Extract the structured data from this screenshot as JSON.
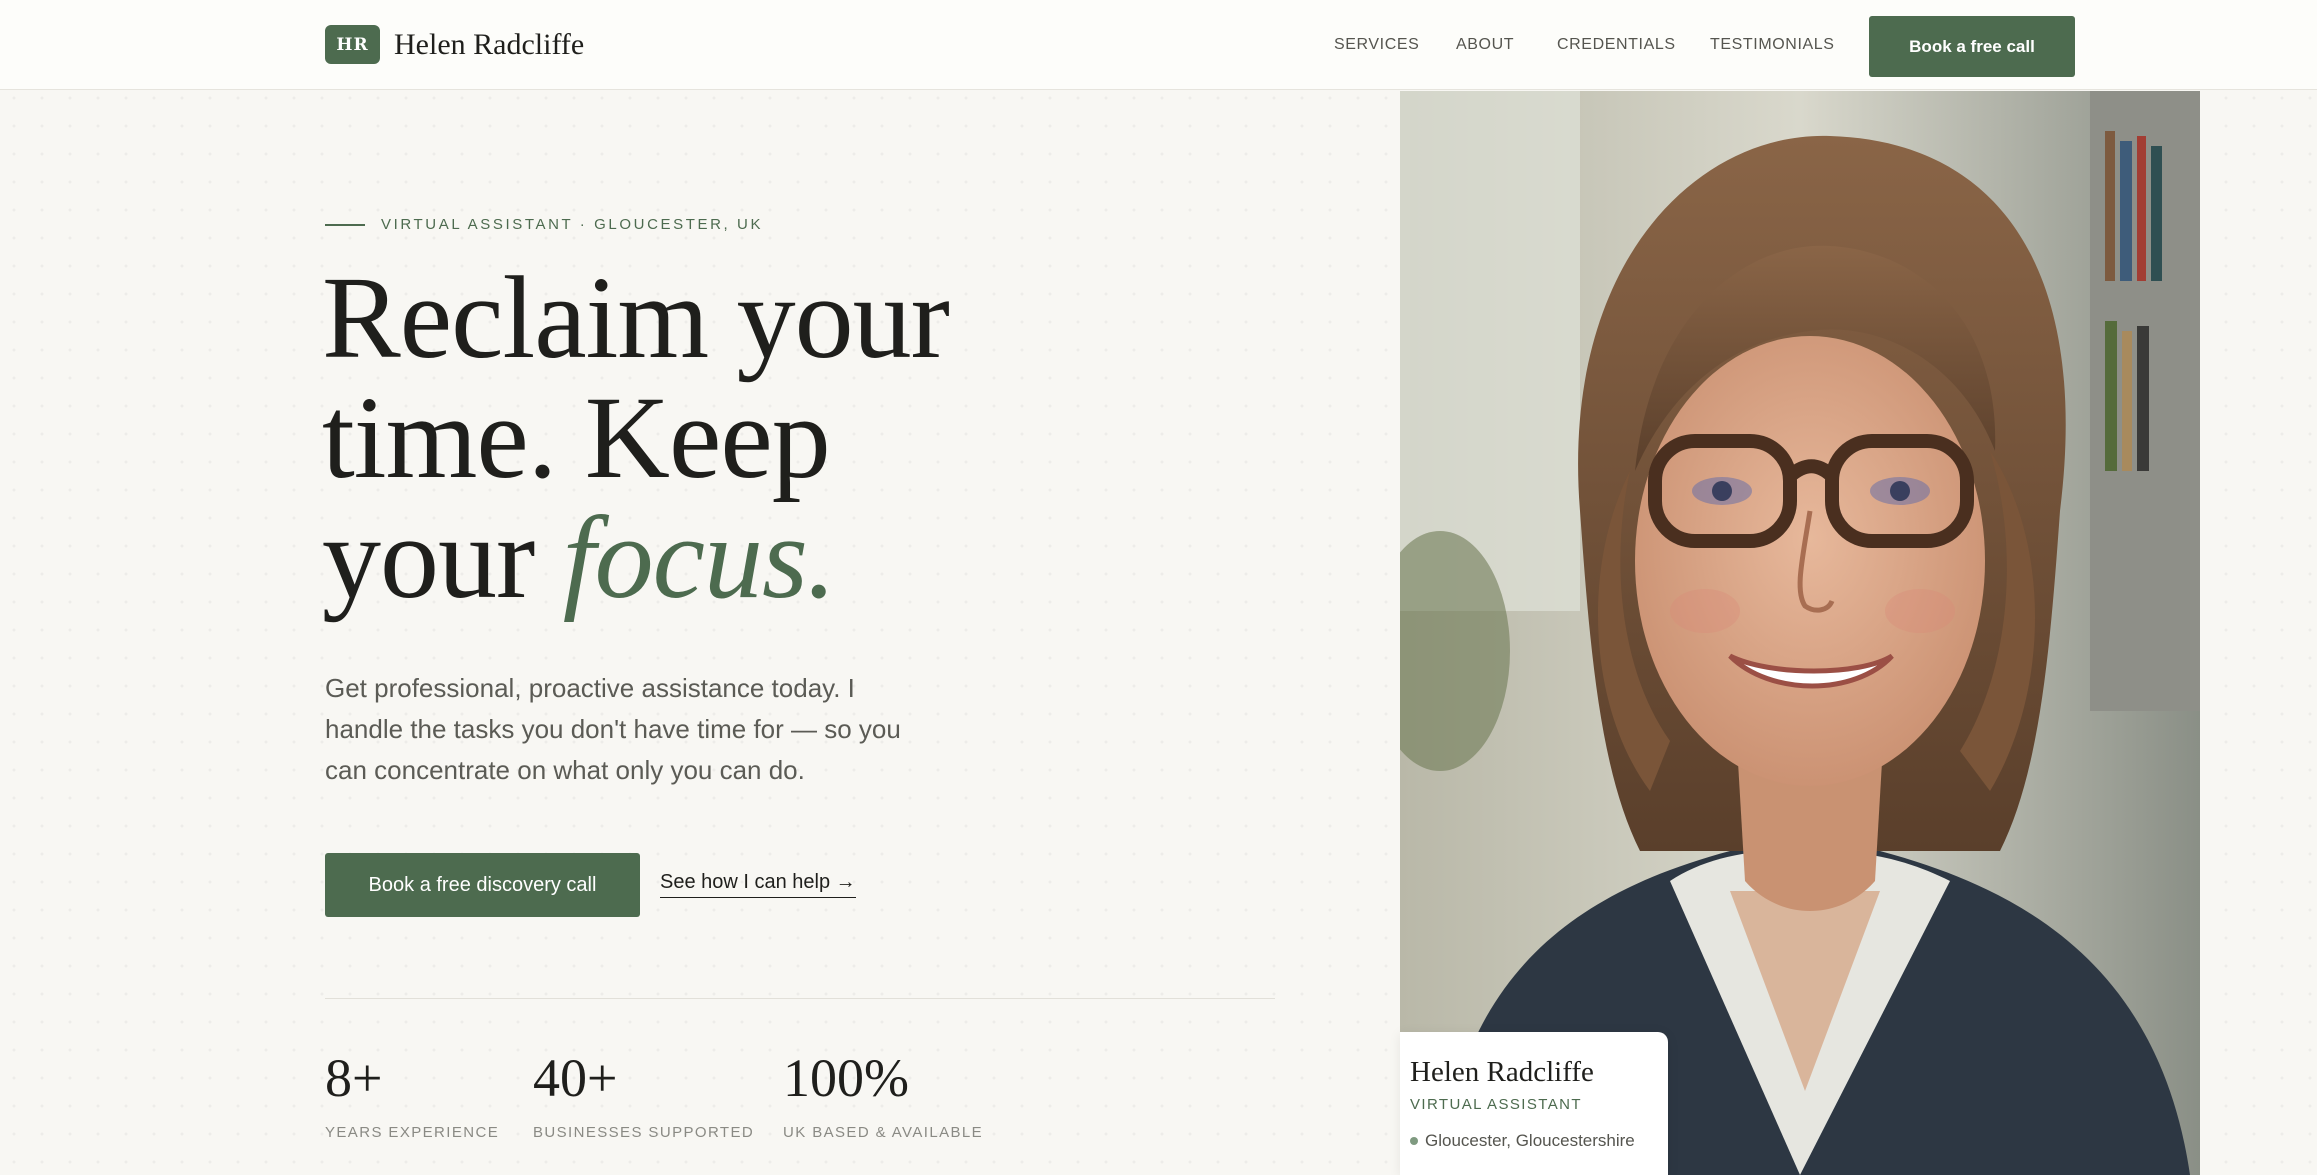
{
  "header": {
    "brand_initials": "HR",
    "brand_name": "Helen Radcliffe",
    "nav": [
      "SERVICES",
      "ABOUT",
      "CREDENTIALS",
      "TESTIMONIALS"
    ],
    "cta_label": "Book a free call"
  },
  "hero": {
    "eyebrow": "VIRTUAL ASSISTANT · GLOUCESTER, UK",
    "headline_line1": "Reclaim your",
    "headline_line2": "time. Keep",
    "headline_line3_plain": "your",
    "headline_line3_accent": "focus.",
    "lead": "Get professional, proactive assistance today. I handle the tasks you don't have time for — so you can concentrate on what only you can do.",
    "primary_cta": "Book a free discovery call",
    "secondary_cta": "See how I can help →",
    "stats": [
      {
        "value": "8+",
        "label": "YEARS EXPERIENCE"
      },
      {
        "value": "40+",
        "label": "BUSINESSES SUPPORTED"
      },
      {
        "value": "100%",
        "label": "UK BASED & AVAILABLE"
      }
    ]
  },
  "portrait_card": {
    "name": "Helen Radcliffe",
    "role": "VIRTUAL ASSISTANT",
    "location": "Gloucester, Gloucestershire"
  },
  "colors": {
    "accent": "#4d6b4f",
    "background": "#f8f7f3",
    "text": "#1f1f1c",
    "muted": "#8a8a84"
  }
}
